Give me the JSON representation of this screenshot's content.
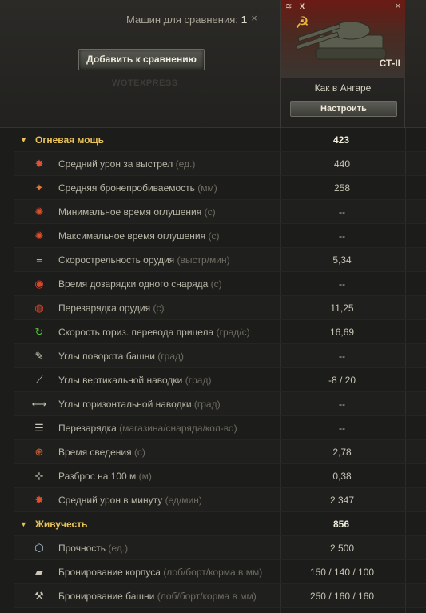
{
  "header": {
    "compare_label": "Машин для сравнения:",
    "compare_count": "1",
    "close_icon": "×",
    "add_button": "Добавить к сравнению",
    "watermark": "WOTEXPRESS"
  },
  "tank": {
    "tier": "X",
    "name": "СТ-II",
    "subtitle": "Как в Ангаре",
    "setup_button": "Настроить",
    "close_icon": "×"
  },
  "sections": [
    {
      "title": "Огневая мощь",
      "value": "423",
      "rows": [
        {
          "icon": "damage-icon",
          "label": "Средний урон за выстрел",
          "unit": "(ед.)",
          "value": "440"
        },
        {
          "icon": "penetration-icon",
          "label": "Средняя бронепробиваемость",
          "unit": "(мм)",
          "value": "258"
        },
        {
          "icon": "stun-min-icon",
          "label": "Минимальное время оглушения",
          "unit": "(с)",
          "value": "--"
        },
        {
          "icon": "stun-max-icon",
          "label": "Максимальное время оглушения",
          "unit": "(с)",
          "value": "--"
        },
        {
          "icon": "rate-of-fire-icon",
          "label": "Скорострельность орудия",
          "unit": "(выстр/мин)",
          "value": "5,34"
        },
        {
          "icon": "shell-reload-icon",
          "label": "Время дозарядки одного снаряда",
          "unit": "(с)",
          "value": "--"
        },
        {
          "icon": "reload-icon",
          "label": "Перезарядка орудия",
          "unit": "(с)",
          "value": "11,25"
        },
        {
          "icon": "gun-traverse-icon",
          "label": "Скорость гориз. перевода прицела",
          "unit": "(град/с)",
          "value": "16,69"
        },
        {
          "icon": "turret-angle-icon",
          "label": "Углы поворота башни",
          "unit": "(град)",
          "value": "--"
        },
        {
          "icon": "elevation-icon",
          "label": "Углы вертикальной наводки",
          "unit": "(град)",
          "value": "-8 / 20"
        },
        {
          "icon": "horizontal-aim-icon",
          "label": "Углы горизонтальной наводки",
          "unit": "(град)",
          "value": "--"
        },
        {
          "icon": "magazine-icon",
          "label": "Перезарядка",
          "unit": "(магазина/снаряда/кол-во)",
          "value": "--"
        },
        {
          "icon": "aim-time-icon",
          "label": "Время сведения",
          "unit": "(с)",
          "value": "2,78"
        },
        {
          "icon": "dispersion-icon",
          "label": "Разброс на 100 м",
          "unit": "(м)",
          "value": "0,38"
        },
        {
          "icon": "dpm-icon",
          "label": "Средний урон в минуту",
          "unit": "(ед/мин)",
          "value": "2 347"
        }
      ]
    },
    {
      "title": "Живучесть",
      "value": "856",
      "rows": [
        {
          "icon": "hitpoints-icon",
          "label": "Прочность",
          "unit": "(ед.)",
          "value": "2 500"
        },
        {
          "icon": "hull-armor-icon",
          "label": "Бронирование корпуса",
          "unit": "(лоб/борт/корма в мм)",
          "value": "150 / 140 / 100"
        },
        {
          "icon": "turret-armor-icon",
          "label": "Бронирование башни",
          "unit": "(лоб/борт/корма в мм)",
          "value": "250 / 160 / 160"
        }
      ]
    }
  ],
  "colors": {
    "section_accent": "#e8c35a",
    "background": "#1c1c1a"
  }
}
